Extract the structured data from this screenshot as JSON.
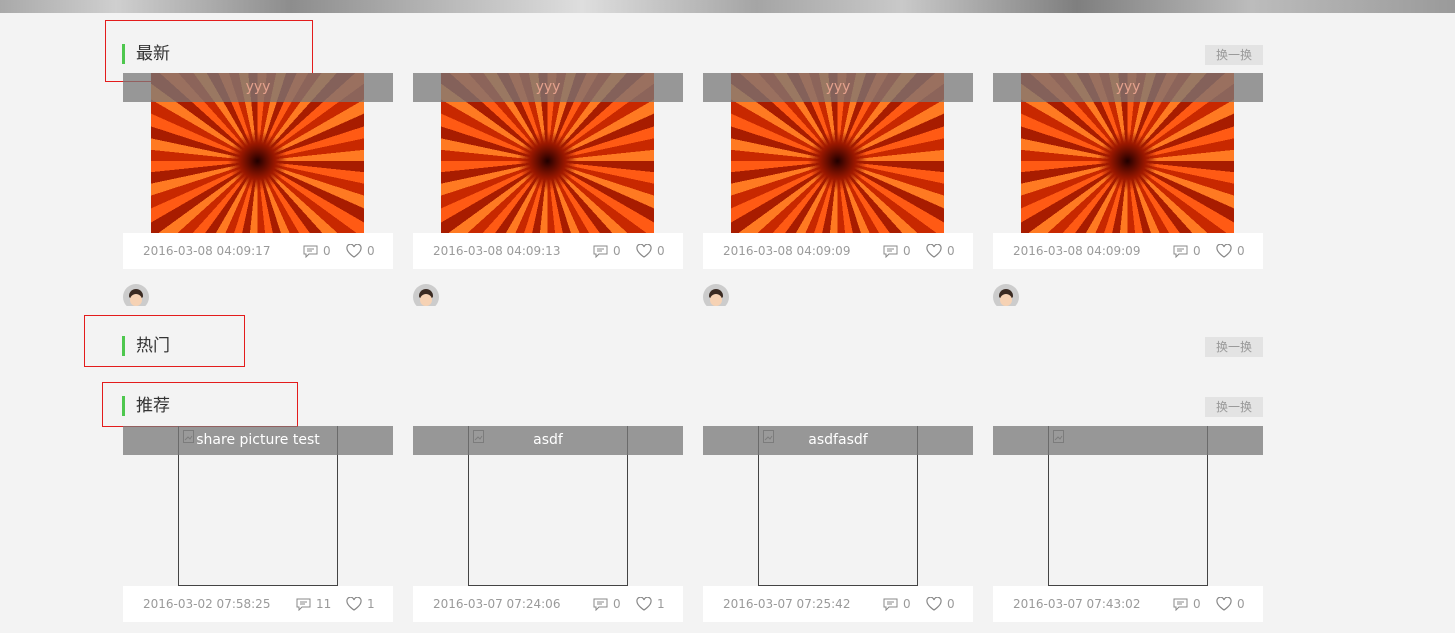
{
  "sections": [
    {
      "title": "最新",
      "swap": "换一换"
    },
    {
      "title": "热门",
      "swap": "换一换"
    },
    {
      "title": "推荐",
      "swap": "换一换"
    }
  ],
  "latest": [
    {
      "title": "yyy",
      "date": "2016-03-08 04:09:17",
      "comments": "0",
      "likes": "0"
    },
    {
      "title": "yyy",
      "date": "2016-03-08 04:09:13",
      "comments": "0",
      "likes": "0"
    },
    {
      "title": "yyy",
      "date": "2016-03-08 04:09:09",
      "comments": "0",
      "likes": "0"
    },
    {
      "title": "yyy",
      "date": "2016-03-08 04:09:09",
      "comments": "0",
      "likes": "0"
    }
  ],
  "recommended": [
    {
      "title": "share picture test",
      "date": "2016-03-02 07:58:25",
      "comments": "11",
      "likes": "1"
    },
    {
      "title": "asdf",
      "date": "2016-03-07 07:24:06",
      "comments": "0",
      "likes": "1"
    },
    {
      "title": "asdfasdf",
      "date": "2016-03-07 07:25:42",
      "comments": "0",
      "likes": "0"
    },
    {
      "title": "",
      "date": "2016-03-07 07:43:02",
      "comments": "0",
      "likes": "0"
    }
  ]
}
